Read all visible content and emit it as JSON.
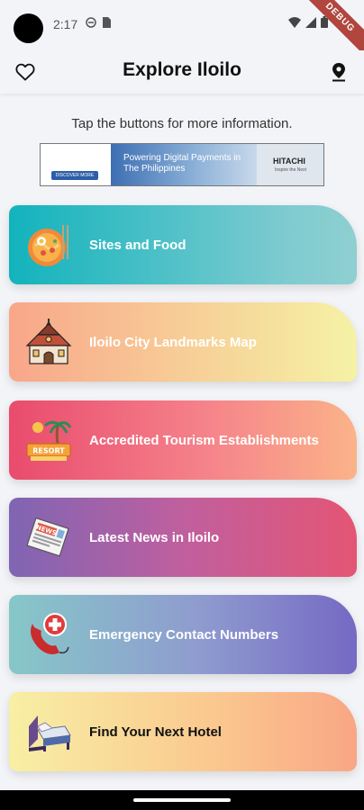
{
  "status_bar": {
    "time": "2:17",
    "debug_label": "DEBUG"
  },
  "app_bar": {
    "title": "Explore Iloilo",
    "left_icon": "heart-icon",
    "right_icon": "map-pin-icon"
  },
  "intro": {
    "text": "Tap the buttons for more information."
  },
  "ad_banner": {
    "headline": "Powering Digital Payments in The Philippines",
    "brand": "HITACHI",
    "tagline": "Inspire the Next",
    "cta": "DISCOVER MORE"
  },
  "menu": {
    "items": [
      {
        "label": "Sites and Food",
        "icon": "food-bowl-icon"
      },
      {
        "label": "Iloilo City Landmarks Map",
        "icon": "church-icon"
      },
      {
        "label": "Accredited Tourism Establishments",
        "icon": "resort-icon"
      },
      {
        "label": "Latest News in Iloilo",
        "icon": "newspaper-icon"
      },
      {
        "label": "Emergency Contact Numbers",
        "icon": "emergency-phone-icon"
      },
      {
        "label": "Find Your Next Hotel",
        "icon": "hotel-bed-icon"
      }
    ]
  }
}
